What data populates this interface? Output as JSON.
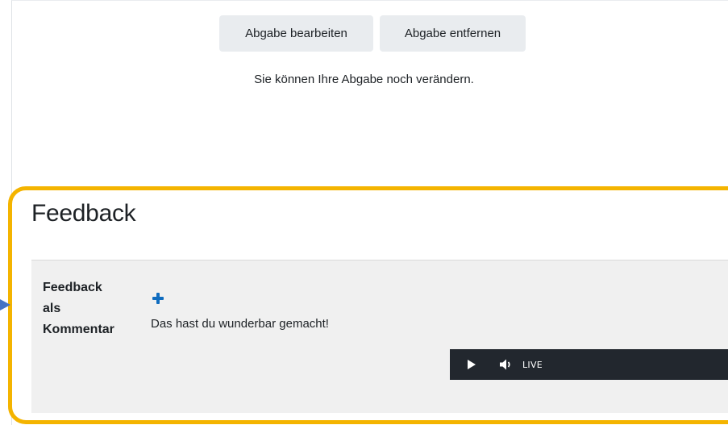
{
  "submission": {
    "edit_button": "Abgabe bearbeiten",
    "remove_button": "Abgabe entfernen",
    "status_text": "Sie können Ihre Abgabe noch verändern."
  },
  "feedback": {
    "heading": "Feedback",
    "row_label_line1": "Feedback",
    "row_label_line2": "als",
    "row_label_line3": "Kommentar",
    "expand_icon": "plus-icon",
    "comment": "Das hast du wunderbar gemacht!",
    "player": {
      "play_icon": "play-icon",
      "volume_icon": "volume-icon",
      "live_label": "LIVE"
    }
  },
  "colors": {
    "highlight_border": "#f4b400",
    "player_bg": "#22272e",
    "accent": "#0f6cbf",
    "panel_bg": "#f0f0f0",
    "button_bg": "#e9ecef",
    "arrow": "#4472c4"
  }
}
